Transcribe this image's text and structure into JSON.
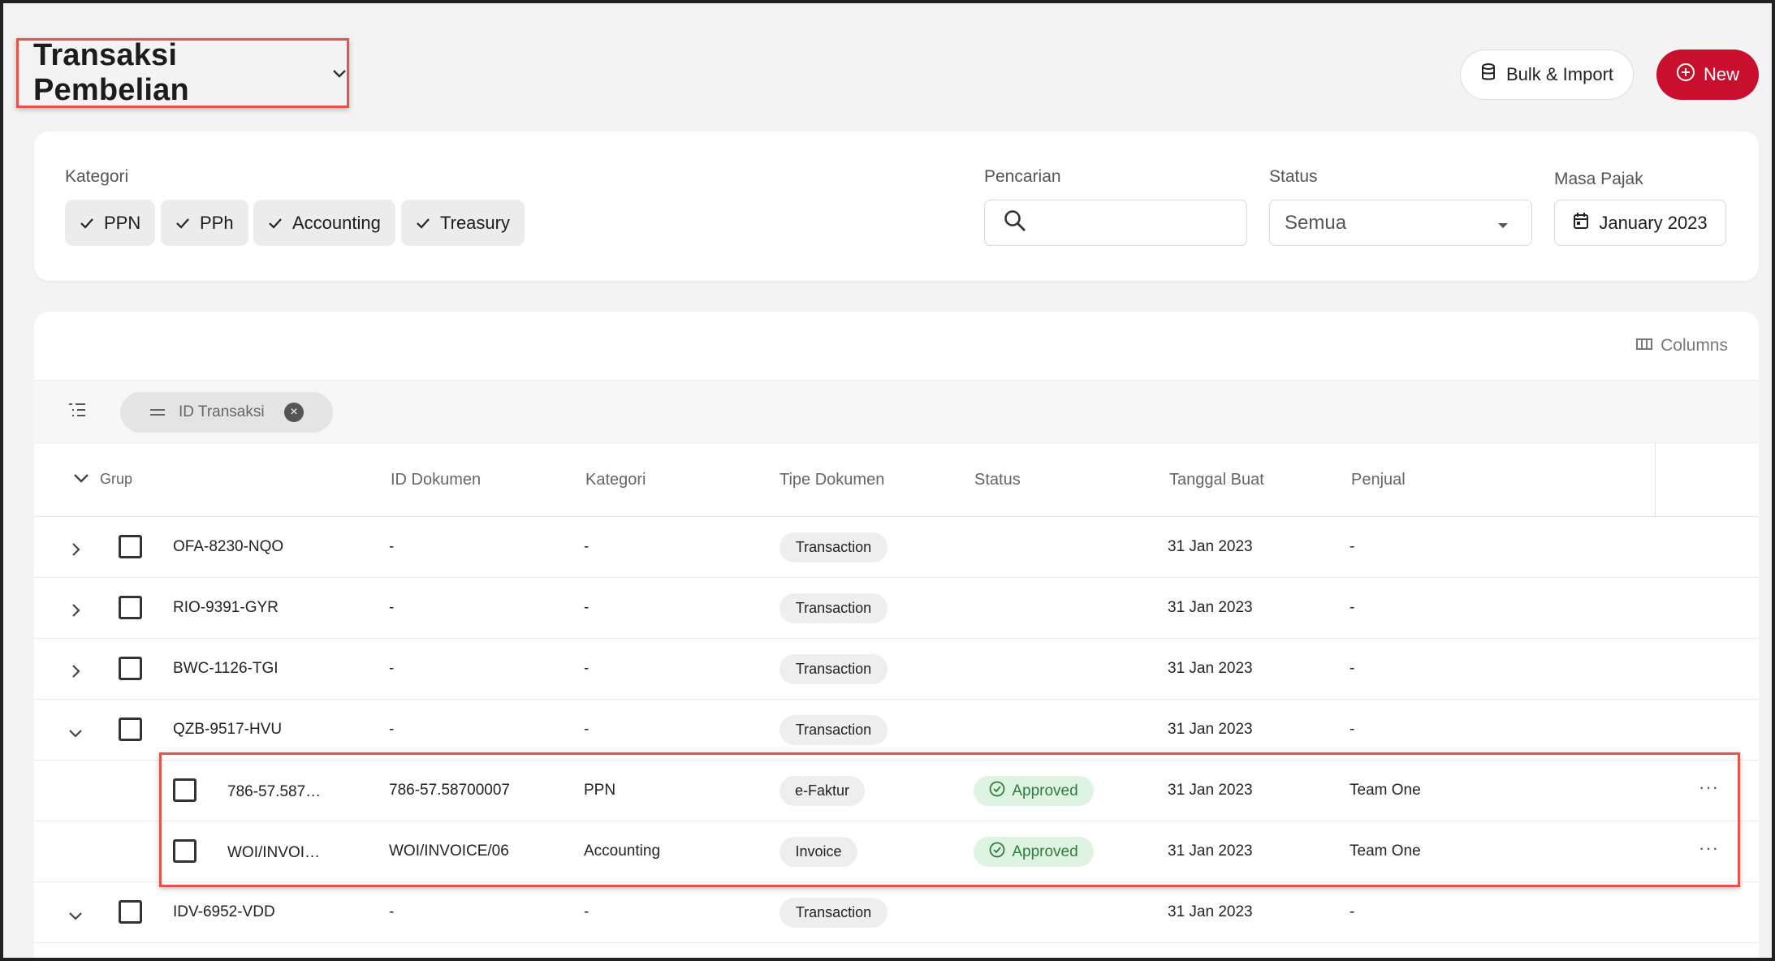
{
  "header": {
    "title": "Transaksi Pembelian",
    "bulk_label": "Bulk & Import",
    "new_label": "New"
  },
  "filters": {
    "kategori_label": "Kategori",
    "kategori_chips": [
      "PPN",
      "PPh",
      "Accounting",
      "Treasury"
    ],
    "pencarian_label": "Pencarian",
    "search_value": "",
    "status_label": "Status",
    "status_value": "Semua",
    "masa_pajak_label": "Masa Pajak",
    "masa_pajak_value": "January 2023"
  },
  "table": {
    "columns_label": "Columns",
    "group_chip_label": "ID Transaksi",
    "headers": {
      "grup": "Grup",
      "id_dokumen": "ID Dokumen",
      "kategori": "Kategori",
      "tipe_dokumen": "Tipe Dokumen",
      "status": "Status",
      "tanggal_buat": "Tanggal Buat",
      "penjual": "Penjual"
    },
    "rows": [
      {
        "group": "OFA-8230-NQO",
        "id_dokumen": "-",
        "kategori": "-",
        "tipe": "Transaction",
        "status": "",
        "tanggal": "31 Jan 2023",
        "penjual": "-"
      },
      {
        "group": "RIO-9391-GYR",
        "id_dokumen": "-",
        "kategori": "-",
        "tipe": "Transaction",
        "status": "",
        "tanggal": "31 Jan 2023",
        "penjual": "-"
      },
      {
        "group": "BWC-1126-TGI",
        "id_dokumen": "-",
        "kategori": "-",
        "tipe": "Transaction",
        "status": "",
        "tanggal": "31 Jan 2023",
        "penjual": "-"
      },
      {
        "group": "QZB-9517-HVU",
        "id_dokumen": "-",
        "kategori": "-",
        "tipe": "Transaction",
        "status": "",
        "tanggal": "31 Jan 2023",
        "penjual": "-"
      },
      {
        "group": "786-57.587…",
        "id_dokumen": "786-57.58700007",
        "kategori": "PPN",
        "tipe": "e-Faktur",
        "status": "Approved",
        "tanggal": "31 Jan 2023",
        "penjual": "Team One"
      },
      {
        "group": "WOI/INVOI…",
        "id_dokumen": "WOI/INVOICE/06",
        "kategori": "Accounting",
        "tipe": "Invoice",
        "status": "Approved",
        "tanggal": "31 Jan 2023",
        "penjual": "Team One"
      },
      {
        "group": "IDV-6952-VDD",
        "id_dokumen": "-",
        "kategori": "-",
        "tipe": "Transaction",
        "status": "",
        "tanggal": "31 Jan 2023",
        "penjual": "-"
      }
    ]
  },
  "colors": {
    "brand_red": "#c8102e",
    "approved_bg": "#dff3e2",
    "approved_text": "#2f7d3a",
    "highlight": "#e5534b"
  },
  "icons": [
    "chevron-down-icon",
    "database-icon",
    "plus-circle-icon",
    "check-icon",
    "search-icon",
    "caret-down-icon",
    "calendar-icon",
    "columns-icon",
    "list-indent-icon",
    "drag-handle-icon",
    "close-circle-icon",
    "chevron-right-icon",
    "check-circle-icon",
    "more-horizontal-icon"
  ]
}
